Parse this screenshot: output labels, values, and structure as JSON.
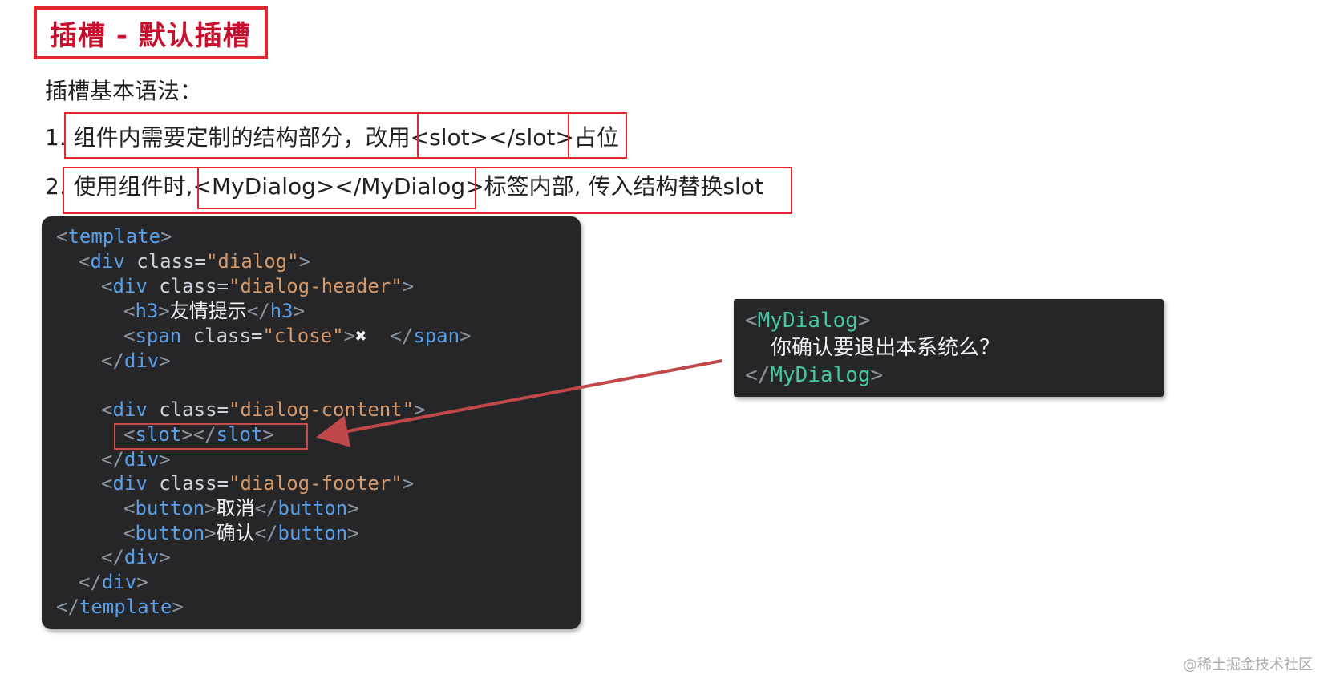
{
  "title": "插槽 - 默认插槽",
  "intro": "插槽基本语法：",
  "point1": {
    "num": "1.",
    "before": "组件内需要定制的结构部分，改用",
    "code": "<slot></slot>",
    "after": "占位"
  },
  "point2": {
    "num": "2.",
    "before": "使用组件时,",
    "code": "<MyDialog></MyDialog>",
    "after": "标签内部, 传入结构替换slot"
  },
  "template_code": {
    "template_open": "template",
    "div": "div",
    "class_attr": "class",
    "dialog_class": "\"dialog\"",
    "header_class": "\"dialog-header\"",
    "h3": "h3",
    "h3_text": "友情提示",
    "span": "span",
    "close_class": "\"close\"",
    "close_symbol": "✖",
    "content_class": "\"dialog-content\"",
    "slot": "slot",
    "footer_class": "\"dialog-footer\"",
    "button": "button",
    "cancel_text": "取消",
    "confirm_text": "确认"
  },
  "usage_code": {
    "component": "MyDialog",
    "content": "你确认要退出本系统么？"
  },
  "colors": {
    "red": "#e0262f",
    "code_bg": "#262628",
    "tag": "#5aa0e8",
    "string": "#d79a6a",
    "component": "#44c7a7"
  },
  "watermark": "@稀土掘金技术社区"
}
